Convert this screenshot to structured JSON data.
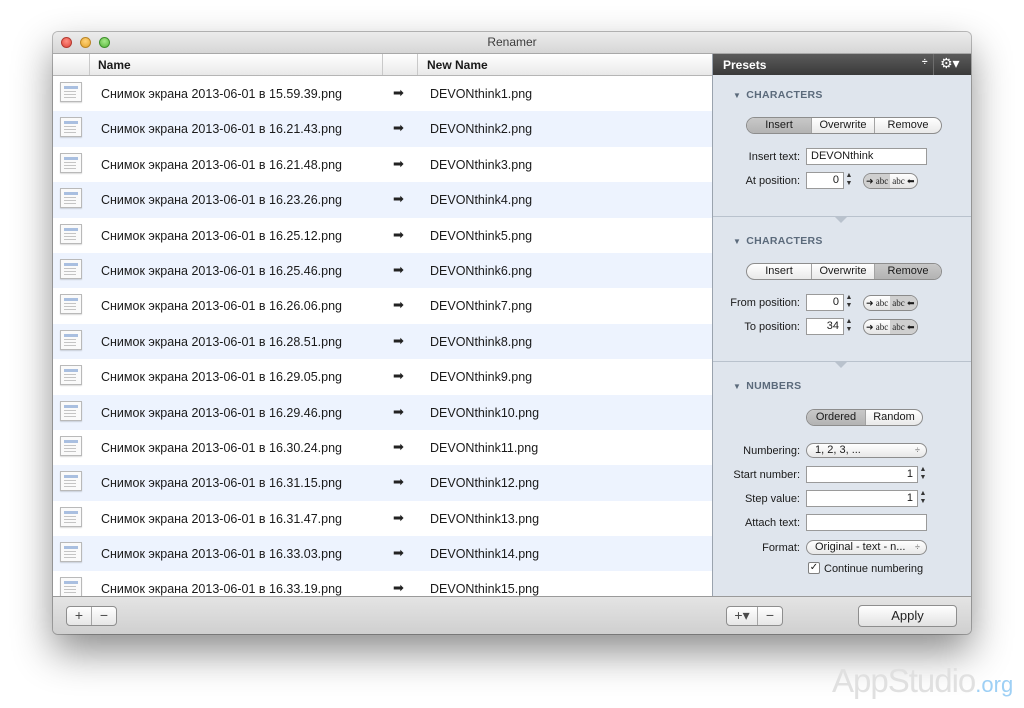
{
  "window": {
    "title": "Renamer"
  },
  "list": {
    "columns": {
      "name": "Name",
      "new_name": "New Name"
    },
    "arrow": "➡",
    "rows": [
      {
        "old": "Снимок экрана 2013-06-01 в 15.59.39.png",
        "new": "DEVONthink1.png"
      },
      {
        "old": "Снимок экрана 2013-06-01 в 16.21.43.png",
        "new": "DEVONthink2.png"
      },
      {
        "old": "Снимок экрана 2013-06-01 в 16.21.48.png",
        "new": "DEVONthink3.png"
      },
      {
        "old": "Снимок экрана 2013-06-01 в 16.23.26.png",
        "new": "DEVONthink4.png"
      },
      {
        "old": "Снимок экрана 2013-06-01 в 16.25.12.png",
        "new": "DEVONthink5.png"
      },
      {
        "old": "Снимок экрана 2013-06-01 в 16.25.46.png",
        "new": "DEVONthink6.png"
      },
      {
        "old": "Снимок экрана 2013-06-01 в 16.26.06.png",
        "new": "DEVONthink7.png"
      },
      {
        "old": "Снимок экрана 2013-06-01 в 16.28.51.png",
        "new": "DEVONthink8.png"
      },
      {
        "old": "Снимок экрана 2013-06-01 в 16.29.05.png",
        "new": "DEVONthink9.png"
      },
      {
        "old": "Снимок экрана 2013-06-01 в 16.29.46.png",
        "new": "DEVONthink10.png"
      },
      {
        "old": "Снимок экрана 2013-06-01 в 16.30.24.png",
        "new": "DEVONthink11.png"
      },
      {
        "old": "Снимок экрана 2013-06-01 в 16.31.15.png",
        "new": "DEVONthink12.png"
      },
      {
        "old": "Снимок экрана 2013-06-01 в 16.31.47.png",
        "new": "DEVONthink13.png"
      },
      {
        "old": "Снимок экрана 2013-06-01 в 16.33.03.png",
        "new": "DEVONthink14.png"
      },
      {
        "old": "Снимок экрана 2013-06-01 в 16.33.19.png",
        "new": "DEVONthink15.png"
      }
    ]
  },
  "bottom": {
    "add": "+",
    "remove": "−",
    "preset_add": "+▾",
    "preset_remove": "−",
    "apply": "Apply"
  },
  "presets": {
    "title": "Presets",
    "popup_arrows": "÷",
    "gear": "⚙▾",
    "insert_section": {
      "title": "CHARACTERS",
      "modes": [
        "Insert",
        "Overwrite",
        "Remove"
      ],
      "selected": "Insert",
      "insert_text_label": "Insert text:",
      "insert_text_value": "DEVONthink",
      "at_position_label": "At position:",
      "at_position_value": "0",
      "direction_left": "➜ abc",
      "direction_right": "abc ⬅"
    },
    "remove_section": {
      "title": "CHARACTERS",
      "modes": [
        "Insert",
        "Overwrite",
        "Remove"
      ],
      "selected": "Remove",
      "from_label": "From position:",
      "from_value": "0",
      "to_label": "To position:",
      "to_value": "34",
      "direction_left": "➜ abc",
      "direction_right": "abc ⬅"
    },
    "numbers_section": {
      "title": "NUMBERS",
      "modes": [
        "Ordered",
        "Random"
      ],
      "selected": "Ordered",
      "numbering_label": "Numbering:",
      "numbering_value": "1, 2, 3, ...",
      "start_label": "Start number:",
      "start_value": "1",
      "step_label": "Step value:",
      "step_value": "1",
      "attach_label": "Attach text:",
      "attach_value": "",
      "format_label": "Format:",
      "format_value": "Original - text - n...",
      "continue_label": "Continue numbering",
      "continue_checked": true
    }
  },
  "watermark": {
    "main": "AppStudio",
    "suffix": ".org"
  }
}
